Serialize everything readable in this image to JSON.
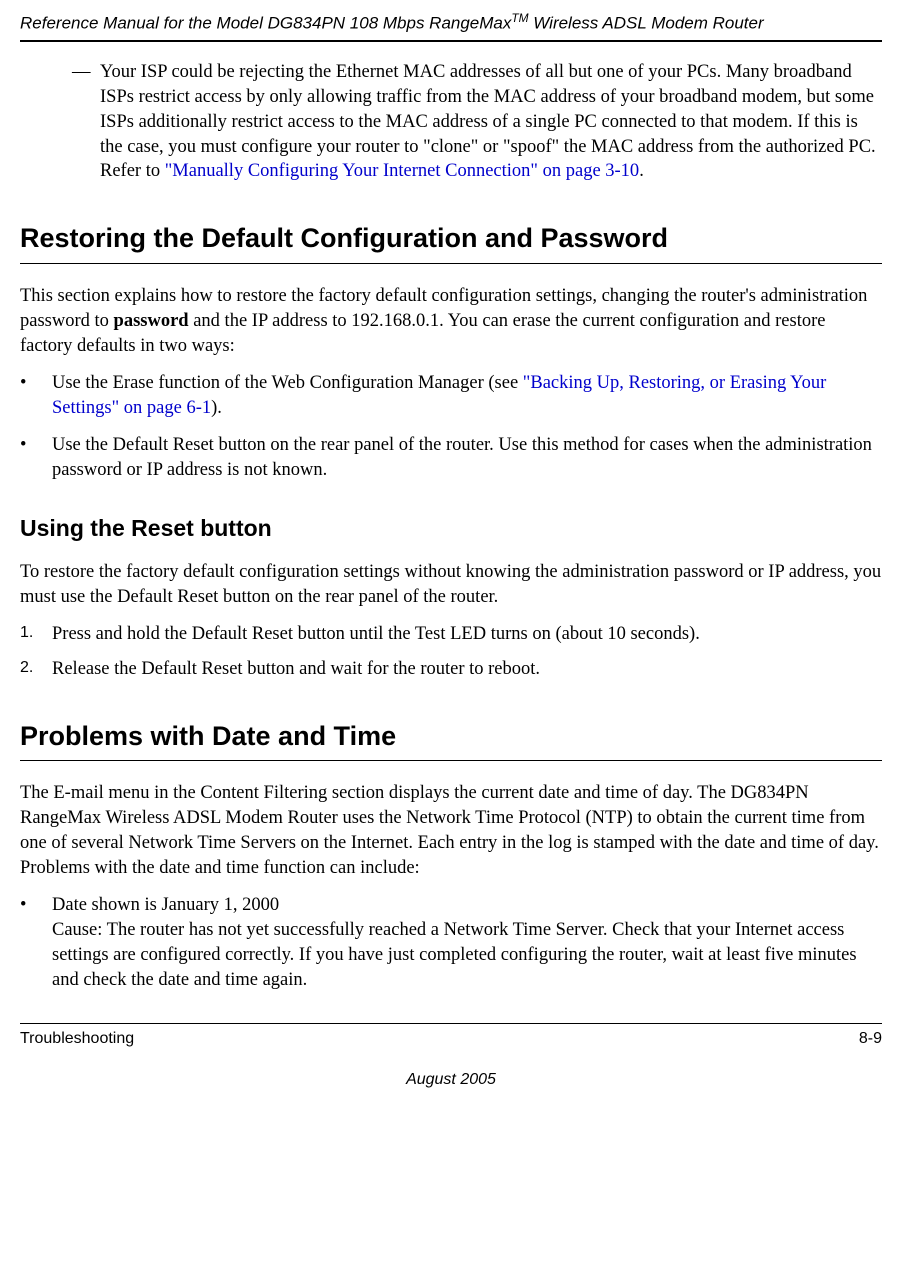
{
  "header": {
    "title_pre": "Reference Manual for the Model DG834PN 108 Mbps RangeMax",
    "title_tm": "TM",
    "title_post": " Wireless ADSL Modem Router"
  },
  "dash_item": {
    "dash": "—",
    "text_pre": "Your ISP could be rejecting the Ethernet MAC addresses of all but one of your PCs. Many broadband ISPs restrict access by only allowing traffic from the MAC address of your broadband modem, but some ISPs additionally restrict access to the MAC address of a single PC connected to that modem. If this is the case, you must configure your router to \"clone\" or \"spoof\" the MAC address from the authorized PC. Refer to ",
    "link": "\"Manually Configuring Your Internet Connection\" on page 3-10",
    "text_post": "."
  },
  "sections": {
    "restoring": {
      "heading": "Restoring the Default Configuration and Password",
      "intro_pre": "This section explains how to restore the factory default configuration settings, changing the router's administration password to ",
      "intro_bold": "password",
      "intro_post": " and the IP address to 192.168.0.1. You can erase the current configuration and restore factory defaults in two ways:",
      "bullets": [
        {
          "pre": "Use the Erase function of the Web Configuration Manager (see ",
          "link": "\"Backing Up, Restoring, or Erasing Your Settings\" on page 6-1",
          "post": ")."
        },
        {
          "pre": "Use the Default Reset button on the rear panel of the router. Use this method for cases when the administration password or IP address is not known.",
          "link": "",
          "post": ""
        }
      ]
    },
    "reset": {
      "heading": "Using the Reset button",
      "intro": "To restore the factory default configuration settings without knowing the administration password or IP address, you must use the Default Reset button on the rear panel of the router.",
      "steps": [
        {
          "n": "1.",
          "text": "Press and hold the Default Reset button until the Test LED turns on (about 10 seconds)."
        },
        {
          "n": "2.",
          "text": "Release the Default Reset button and wait for the router to reboot."
        }
      ]
    },
    "datetime": {
      "heading": "Problems with Date and Time",
      "intro": "The E-mail menu in the Content Filtering section displays the current date and time of day. The DG834PN RangeMax Wireless ADSL Modem Router uses the Network Time Protocol (NTP) to obtain the current time from one of several Network Time Servers on the Internet. Each entry in the log is stamped with the date and time of day. Problems with the date and time function can include:",
      "bullets": [
        {
          "line1": "Date shown is January 1, 2000",
          "line2": "Cause: The router has not yet successfully reached a Network Time Server. Check that your Internet access settings are configured correctly. If you have just completed configuring the router, wait at least five minutes and check the date and time again."
        }
      ]
    }
  },
  "footer": {
    "left": "Troubleshooting",
    "right": "8-9",
    "date": "August 2005"
  },
  "bullet_char": "•"
}
